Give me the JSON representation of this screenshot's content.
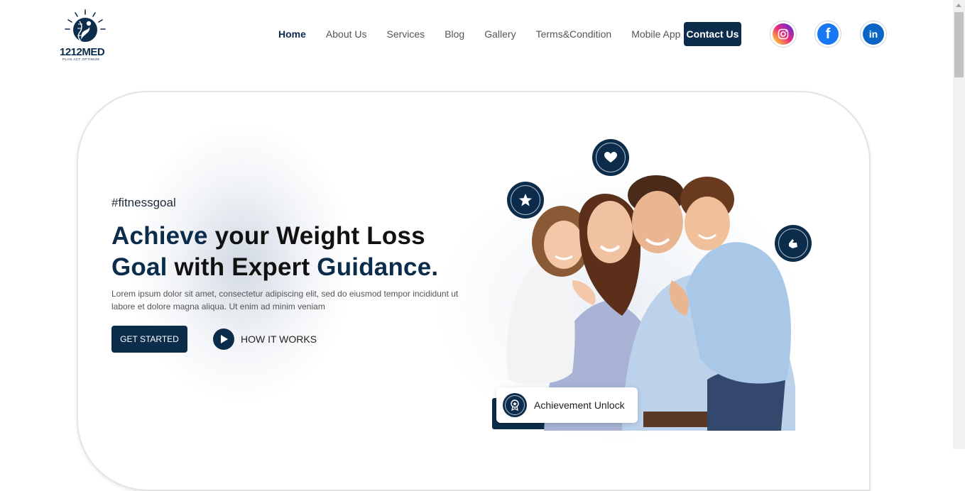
{
  "brand": {
    "name": "1212MED",
    "tagline": "PLAN ACT OPTIMIZE"
  },
  "nav": {
    "items": [
      {
        "label": "Home",
        "active": true
      },
      {
        "label": "About Us",
        "active": false
      },
      {
        "label": "Services",
        "active": false
      },
      {
        "label": "Blog",
        "active": false
      },
      {
        "label": "Gallery",
        "active": false
      },
      {
        "label": "Terms&Condition",
        "active": false
      },
      {
        "label": "Mobile App",
        "active": false
      }
    ],
    "contact_label": "Contact Us"
  },
  "social": [
    {
      "name": "instagram-icon",
      "glyph": "◎"
    },
    {
      "name": "facebook-icon",
      "glyph": "f"
    },
    {
      "name": "linkedin-icon",
      "glyph": "in"
    }
  ],
  "hero": {
    "hashtag": "#fitnessgoal",
    "headline": {
      "w1": "Achieve",
      "w2": " your Weight Loss",
      "w3": "Goal",
      "w4": " with Expert ",
      "w5": "Guidance."
    },
    "body": "Lorem ipsum dolor sit amet, consectetur adipiscing elit, sed do eiusmod tempor incididunt ut labore et dolore magna aliqua. Ut enim ad minim veniam",
    "cta_primary": "GET STARTED",
    "cta_secondary": "HOW IT WORKS"
  },
  "badges": {
    "heart": "heart-icon",
    "star": "star-icon",
    "hand": "hand-icon"
  },
  "achievement": {
    "label": "Achievement Unlock",
    "icon": "award-icon"
  },
  "colors": {
    "primary": "#0c2c4b",
    "text": "#222222",
    "muted": "#555555"
  }
}
